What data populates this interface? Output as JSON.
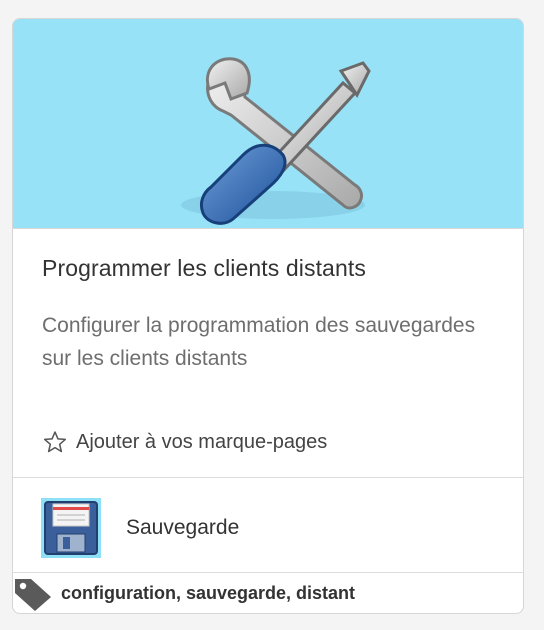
{
  "card": {
    "title": "Programmer les clients distants",
    "description": "Configurer la programmation des sauvegardes sur les clients distants",
    "hero_icon": "tools-wrench-screwdriver-icon",
    "hero_color": "#98e2f8"
  },
  "bookmark": {
    "icon": "star-outline-icon",
    "label": "Ajouter à vos marque-pages"
  },
  "app": {
    "icon": "floppy-disk-icon",
    "name": "Sauvegarde"
  },
  "tags": {
    "icon": "tag-icon",
    "text": "configuration, sauvegarde, distant"
  }
}
